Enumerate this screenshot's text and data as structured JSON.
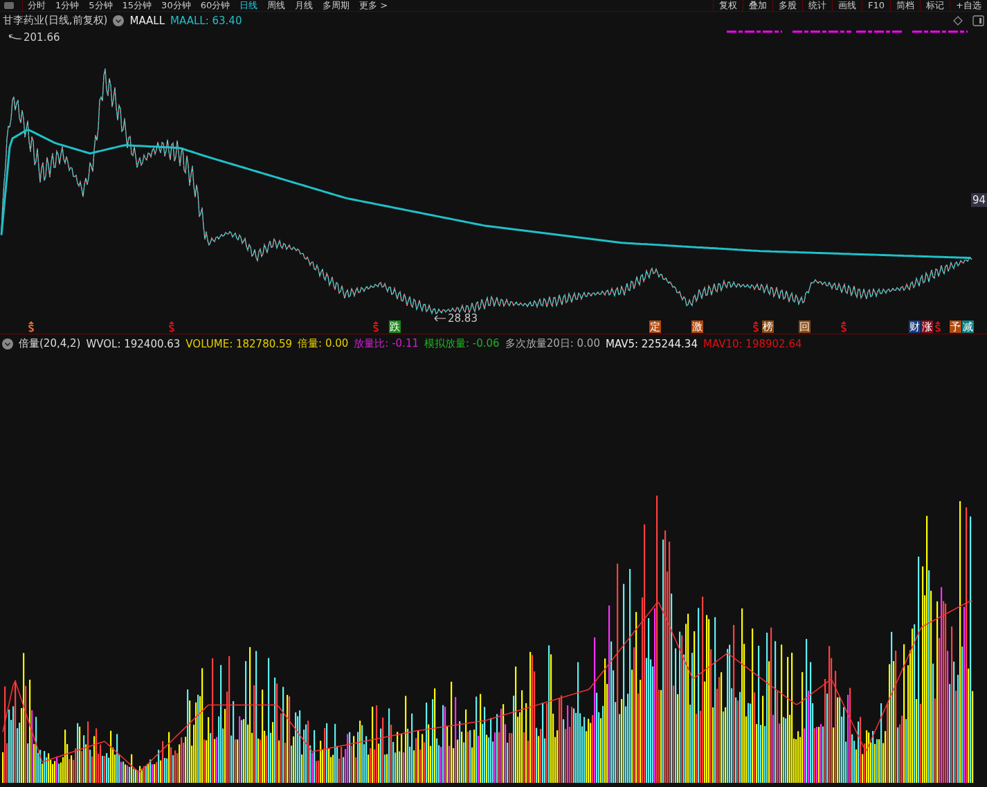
{
  "toolbar": {
    "tabs": [
      {
        "label": "分时",
        "selected": false
      },
      {
        "label": "1分钟",
        "selected": false
      },
      {
        "label": "5分钟",
        "selected": false
      },
      {
        "label": "15分钟",
        "selected": false
      },
      {
        "label": "30分钟",
        "selected": false
      },
      {
        "label": "60分钟",
        "selected": false
      },
      {
        "label": "日线",
        "selected": true
      },
      {
        "label": "周线",
        "selected": false
      },
      {
        "label": "月线",
        "selected": false
      },
      {
        "label": "多周期",
        "selected": false
      },
      {
        "label": "更多 >",
        "selected": false
      }
    ],
    "buttons": [
      "复权",
      "叠加",
      "多股",
      "统计",
      "画线",
      "F10",
      "简档",
      "标记",
      "+自选"
    ]
  },
  "price_panel": {
    "title": "甘李药业(日线,前复权)",
    "indicator": "MAALL",
    "indicator_value": "MAALL: 63.40",
    "high_label": "201.66",
    "low_label": "28.83",
    "axis_label": "94",
    "markers": [
      {
        "kind": "s",
        "color": "#f07030"
      },
      {
        "kind": "s",
        "color": "#e01010"
      },
      {
        "kind": "s",
        "color": "#e01010"
      },
      {
        "kind": "tag",
        "text": "跌",
        "color": "#1a8a1a"
      },
      {
        "kind": "tag",
        "text": "定",
        "color": "#b04a10"
      },
      {
        "kind": "tag",
        "text": "激",
        "color": "#b04a10"
      },
      {
        "kind": "s",
        "color": "#e01010"
      },
      {
        "kind": "tag",
        "text": "榜",
        "color": "#8a4a10"
      },
      {
        "kind": "tag",
        "text": "回",
        "color": "#8a4a10"
      },
      {
        "kind": "s",
        "color": "#e01010"
      },
      {
        "kind": "tag",
        "text": "财",
        "color": "#1a3a80"
      },
      {
        "kind": "tag",
        "text": "涨",
        "color": "#8a1020"
      },
      {
        "kind": "s",
        "color": "#e01010"
      },
      {
        "kind": "tag",
        "text": "予",
        "color": "#b04a10"
      },
      {
        "kind": "tag",
        "text": "减",
        "color": "#108080"
      }
    ]
  },
  "volume_panel": {
    "title": "倍量(20,4,2)",
    "legend": [
      {
        "label": "WVOL: 192400.63",
        "color": "#dddddd"
      },
      {
        "label": "VOLUME: 182780.59",
        "color": "#e8d000"
      },
      {
        "label": "倍量: 0.00",
        "color": "#e8d000"
      },
      {
        "label": "放量比: -0.11",
        "color": "#d020d0"
      },
      {
        "label": "模拟放量: -0.06",
        "color": "#20b020"
      },
      {
        "label": "多次放量20日: 0.00",
        "color": "#aaaaaa"
      },
      {
        "label": "MAV5: 225244.34",
        "color": "#eeeeee"
      },
      {
        "label": "MAV10: 198902.64",
        "color": "#e01010"
      }
    ]
  }
}
